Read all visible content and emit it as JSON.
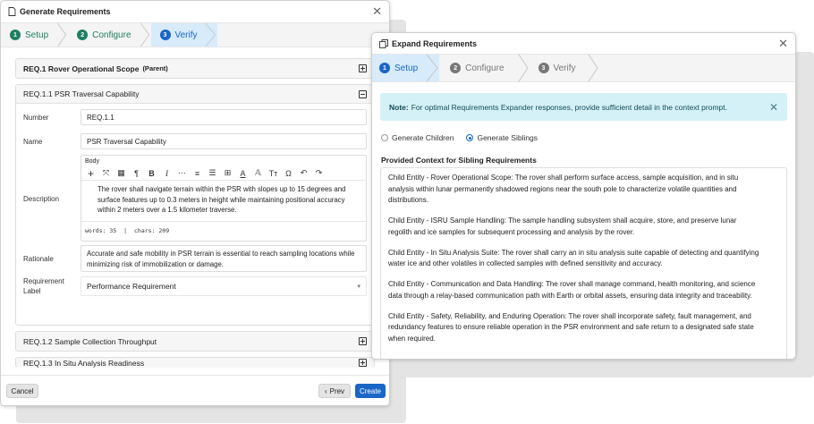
{
  "left_dialog": {
    "title": "Generate Requirements",
    "steps": [
      {
        "num": "1",
        "label": "Setup"
      },
      {
        "num": "2",
        "label": "Configure"
      },
      {
        "num": "3",
        "label": "Verify"
      }
    ],
    "parent": {
      "id": "REQ.1 Rover Operational Scope",
      "tag": "(Parent)"
    },
    "expanded_header": "REQ.1.1 PSR Traversal Capability",
    "form": {
      "number_label": "Number",
      "number_value": "REQ.1.1",
      "name_label": "Name",
      "name_value": "PSR Traversal Capability",
      "body_label": "Body",
      "description_label": "Description",
      "description_lines": [
        "The rover shall navigate terrain within the PSR with slopes up to 15 degrees and",
        "surface features up to 0.3 meters in height while maintaining positional accuracy",
        "within 2 meters over a 1.5 kilometer traverse."
      ],
      "words": "words: 35",
      "chars": "chars: 209",
      "rationale_label": "Rationale",
      "rationale_lines": [
        "Accurate and safe mobility in PSR terrain is essential to reach sampling locations while",
        "minimizing risk of immobilization or damage."
      ],
      "req_label_line1": "Requirement",
      "req_label_line2": "Label",
      "req_label_value": "Performance Requirement"
    },
    "collapsed": [
      "REQ.1.2 Sample Collection Throughput",
      "REQ.1.3 In Situ Analysis Readiness"
    ],
    "buttons": {
      "cancel": "Cancel",
      "prev": "Prev",
      "create": "Create"
    }
  },
  "right_dialog": {
    "title": "Expand Requirements",
    "steps": [
      {
        "num": "1",
        "label": "Setup"
      },
      {
        "num": "2",
        "label": "Configure"
      },
      {
        "num": "3",
        "label": "Verify"
      }
    ],
    "note_strong": "Note:",
    "note_text": "For optimal Requirements Expander responses, provide sufficient detail in the context prompt.",
    "radio_children": "Generate Children",
    "radio_siblings": "Generate Siblings",
    "selected_mode": "Generate Siblings",
    "context_title": "Provided Context for Sibling Requirements",
    "context_paragraphs": [
      [
        "Child Entity - Rover Operational Scope: The rover shall perform surface access, sample acquisition, and in situ",
        "analysis within lunar permanently shadowed regions near the south pole to characterize volatile quantities and",
        "distributions."
      ],
      [
        "Child Entity - ISRU Sample Handling: The sample handling subsystem shall acquire, store, and preserve lunar",
        "regolith and ice samples for subsequent processing and analysis by the rover."
      ],
      [
        "Child Entity - In Situ Analysis Suite: The rover shall carry an in situ analysis suite capable of detecting and quantifying",
        "water ice and other volatiles in collected samples with defined sensitivity and accuracy."
      ],
      [
        "Child Entity - Communication and Data Handling: The rover shall manage command, health monitoring, and science",
        "data through a relay-based communication path with Earth or orbital assets, ensuring data integrity and traceability."
      ],
      [
        "Child Entity - Safety, Reliability, and Enduring Operation: The rover shall incorporate safety, fault management, and",
        "redundancy features to ensure reliable operation in the PSR environment and safe return to a designated safe state",
        "when required."
      ]
    ]
  },
  "colors": {
    "accent": "#1a66c7",
    "done": "#1e7f61",
    "note_bg": "#d3f1f6",
    "create_bg": "#1a66c7"
  }
}
